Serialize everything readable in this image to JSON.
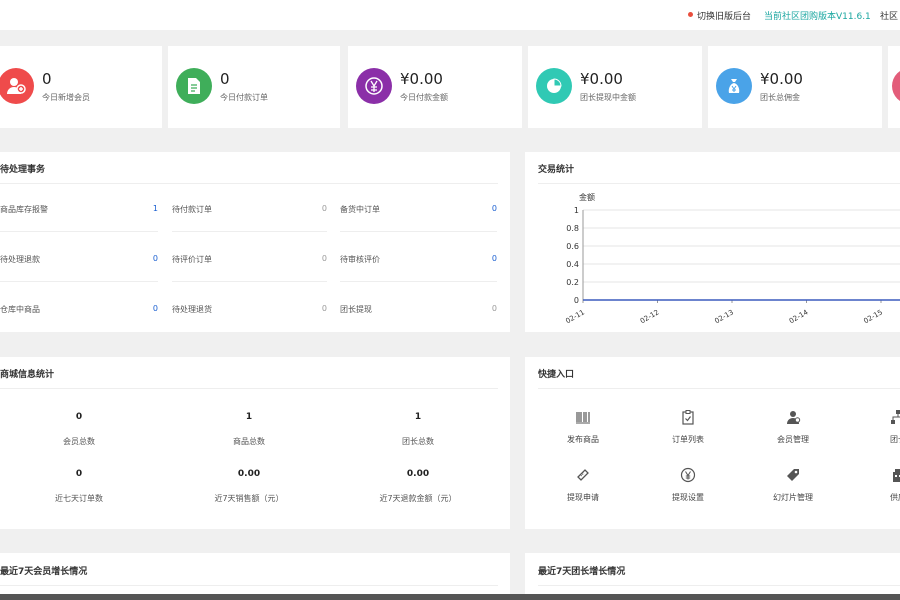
{
  "topbar": {
    "switch_label": "切换旧版后台",
    "version_label": "当前社区团购版本V11.6.1",
    "community_label": "社区"
  },
  "stats": [
    {
      "value": "0",
      "label": "今日新增会员",
      "icon": "user-add-icon",
      "color": "#ef4b4b"
    },
    {
      "value": "0",
      "label": "今日付款订单",
      "icon": "document-icon",
      "color": "#3fae5a"
    },
    {
      "value": "¥0.00",
      "label": "今日付款金额",
      "icon": "yen-icon",
      "color": "#8b2fa8"
    },
    {
      "value": "¥0.00",
      "label": "团长提现中金额",
      "icon": "pie-icon",
      "color": "#30c9b4"
    },
    {
      "value": "¥0.00",
      "label": "团长总佣金",
      "icon": "money-bag-icon",
      "color": "#4aa3e8"
    }
  ],
  "todo": {
    "title": "待处理事务",
    "items": [
      {
        "label": "商品库存报警",
        "value": "1"
      },
      {
        "label": "待付款订单",
        "value": "0"
      },
      {
        "label": "备货中订单",
        "value": "0"
      },
      {
        "label": "待处理退款",
        "value": "0"
      },
      {
        "label": "待评价订单",
        "value": "0"
      },
      {
        "label": "待审核评价",
        "value": "0"
      },
      {
        "label": "仓库中商品",
        "value": "0"
      },
      {
        "label": "待处理退货",
        "value": "0"
      },
      {
        "label": "团长提现",
        "value": "0"
      }
    ]
  },
  "trade": {
    "title": "交易统计",
    "chart_data": {
      "type": "line",
      "ylabel": "金额",
      "x": [
        "02-11",
        "02-12",
        "02-13",
        "02-14",
        "02-15"
      ],
      "y_ticks": [
        "0",
        "0.2",
        "0.4",
        "0.6",
        "0.8",
        "1"
      ],
      "series": [
        {
          "values": [
            0,
            0,
            0,
            0,
            0
          ]
        }
      ],
      "ylim": [
        0,
        1
      ],
      "grid": true
    }
  },
  "mall": {
    "title": "商城信息统计",
    "items": [
      {
        "value": "0",
        "label": "会员总数"
      },
      {
        "value": "1",
        "label": "商品总数"
      },
      {
        "value": "1",
        "label": "团长总数"
      },
      {
        "value": "0",
        "label": "近七天订单数"
      },
      {
        "value": "0.00",
        "label": "近7天销售额（元）"
      },
      {
        "value": "0.00",
        "label": "近7天退款金额（元）"
      }
    ]
  },
  "quick": {
    "title": "快捷入口",
    "items": [
      {
        "label": "发布商品",
        "icon": "barcode-icon"
      },
      {
        "label": "订单列表",
        "icon": "clipboard-check-icon"
      },
      {
        "label": "会员管理",
        "icon": "users-icon"
      },
      {
        "label": "团长",
        "icon": "network-icon"
      },
      {
        "label": "提现申请",
        "icon": "ticket-icon"
      },
      {
        "label": "提现设置",
        "icon": "yen-circle-icon"
      },
      {
        "label": "幻灯片管理",
        "icon": "tag-icon"
      },
      {
        "label": "供应",
        "icon": "building-icon"
      }
    ]
  },
  "member_growth": {
    "title": "最近7天会员增长情况"
  },
  "leader_growth": {
    "title": "最近7天团长增长情况"
  }
}
